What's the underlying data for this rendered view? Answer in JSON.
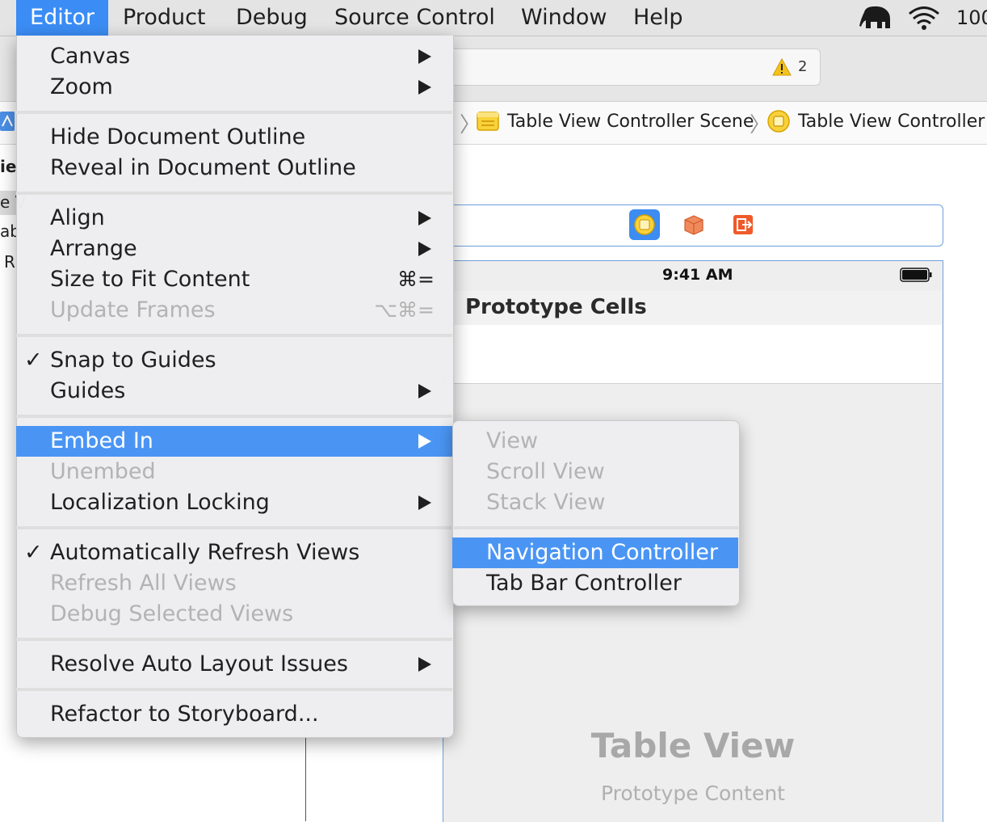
{
  "menubar": {
    "items": [
      "Editor",
      "Product",
      "Debug",
      "Source Control",
      "Window",
      "Help"
    ],
    "battery_text": "100"
  },
  "toolbar": {
    "warning_count": "2"
  },
  "jumpbar": {
    "crumbs": [
      "Table View Controller Scene",
      "Table View Controller"
    ]
  },
  "left_fragments": [
    "ie",
    "e V",
    "ab",
    "R"
  ],
  "scene": {
    "status_time": "9:41 AM",
    "section_title": "Prototype Cells",
    "table_title": "Table View",
    "table_subtitle": "Prototype Content"
  },
  "editor_menu": {
    "items": [
      {
        "label": "Canvas"
      },
      {
        "label": "Zoom"
      },
      {
        "label": "Hide Document Outline"
      },
      {
        "label": "Reveal in Document Outline"
      },
      {
        "label": "Align"
      },
      {
        "label": "Arrange"
      },
      {
        "label": "Size to Fit Content",
        "shortcut": "⌘="
      },
      {
        "label": "Update Frames",
        "shortcut": "⌥⌘="
      },
      {
        "label": "Snap to Guides",
        "check": "✓"
      },
      {
        "label": "Guides"
      },
      {
        "label": "Embed In"
      },
      {
        "label": "Unembed"
      },
      {
        "label": "Localization Locking"
      },
      {
        "label": "Automatically Refresh Views",
        "check": "✓"
      },
      {
        "label": "Refresh All Views"
      },
      {
        "label": "Debug Selected Views"
      },
      {
        "label": "Resolve Auto Layout Issues"
      },
      {
        "label": "Refactor to Storyboard..."
      }
    ]
  },
  "embed_submenu": {
    "items": [
      {
        "label": "View"
      },
      {
        "label": "Scroll View"
      },
      {
        "label": "Stack View"
      },
      {
        "label": "Navigation Controller"
      },
      {
        "label": "Tab Bar Controller"
      }
    ]
  },
  "colors": {
    "accent": "#4a95f4",
    "menubar_active": "#3b8df5",
    "scene_border": "#6fa0db"
  },
  "icons": [
    "elephant-icon",
    "wifi-icon",
    "warning-icon",
    "storyboard-icon",
    "view-controller-icon",
    "first-responder-icon",
    "exit-icon",
    "battery-icon"
  ]
}
